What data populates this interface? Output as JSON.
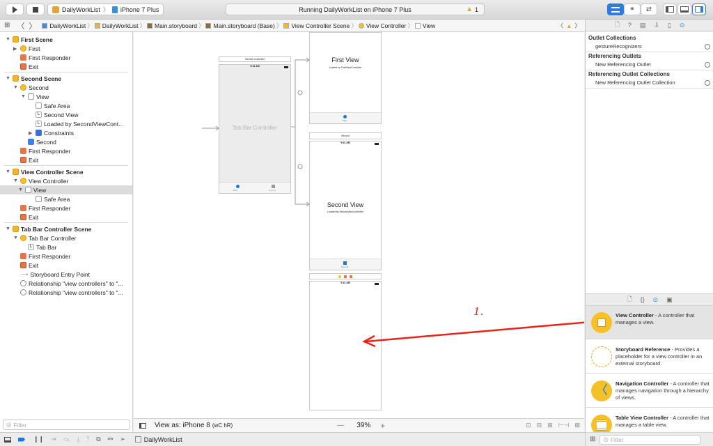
{
  "toolbar": {
    "scheme_name": "DailyWorkList",
    "device": "iPhone 7 Plus",
    "activity": "Running DailyWorkList on iPhone 7 Plus",
    "warning_count": "1"
  },
  "jumpbar": {
    "crumbs": [
      "DailyWorkList",
      "DailyWorkList",
      "Main.storyboard",
      "Main.storyboard (Base)",
      "View Controller Scene",
      "View Controller",
      "View"
    ]
  },
  "navigator": {
    "items": [
      {
        "label": "First Scene",
        "indent": 0,
        "icon": "scene",
        "disc": "▼",
        "bold": true
      },
      {
        "label": "First",
        "indent": 1,
        "icon": "vc",
        "disc": "▶"
      },
      {
        "label": "First Responder",
        "indent": 1,
        "icon": "resp"
      },
      {
        "label": "Exit",
        "indent": 1,
        "icon": "exit"
      },
      {
        "label": "Second Scene",
        "indent": 0,
        "icon": "scene",
        "disc": "▼",
        "bold": true
      },
      {
        "label": "Second",
        "indent": 1,
        "icon": "vc",
        "disc": "▼"
      },
      {
        "label": "View",
        "indent": 2,
        "icon": "view",
        "disc": "▼"
      },
      {
        "label": "Safe Area",
        "indent": 3,
        "icon": "view"
      },
      {
        "label": "Second View",
        "indent": 3,
        "icon": "label"
      },
      {
        "label": "Loaded by SecondViewCont...",
        "indent": 3,
        "icon": "label"
      },
      {
        "label": "Constraints",
        "indent": 3,
        "icon": "constr",
        "disc": "▶"
      },
      {
        "label": "Second",
        "indent": 2,
        "icon": "tab"
      },
      {
        "label": "First Responder",
        "indent": 1,
        "icon": "resp"
      },
      {
        "label": "Exit",
        "indent": 1,
        "icon": "exit"
      },
      {
        "label": "View Controller Scene",
        "indent": 0,
        "icon": "scene",
        "disc": "▼",
        "bold": true
      },
      {
        "label": "View Controller",
        "indent": 1,
        "icon": "vc",
        "disc": "▼"
      },
      {
        "label": "View",
        "indent": 2,
        "icon": "view",
        "disc": "▼",
        "selected": true
      },
      {
        "label": "Safe Area",
        "indent": 3,
        "icon": "view"
      },
      {
        "label": "First Responder",
        "indent": 1,
        "icon": "resp"
      },
      {
        "label": "Exit",
        "indent": 1,
        "icon": "exit"
      },
      {
        "label": "Tab Bar Controller Scene",
        "indent": 0,
        "icon": "scene",
        "disc": "▼",
        "bold": true
      },
      {
        "label": "Tab Bar Controller",
        "indent": 1,
        "icon": "vc",
        "disc": "▼"
      },
      {
        "label": "Tab Bar",
        "indent": 2,
        "icon": "label"
      },
      {
        "label": "First Responder",
        "indent": 1,
        "icon": "resp"
      },
      {
        "label": "Exit",
        "indent": 1,
        "icon": "exit"
      },
      {
        "label": "Storyboard Entry Point",
        "indent": 1,
        "icon": "arrow"
      },
      {
        "label": "Relationship \"view controllers\" to \"...",
        "indent": 1,
        "icon": "circle"
      },
      {
        "label": "Relationship \"view controllers\" to \"...",
        "indent": 1,
        "icon": "circle"
      }
    ],
    "filter_placeholder": "Filter"
  },
  "canvas": {
    "tab_bar_controller": {
      "title": "Tab Bar Controller",
      "label": "Tab Bar Controller",
      "tab1": "First",
      "tab2": "Second",
      "time": "9:41 AM"
    },
    "first_view": {
      "title": "First View",
      "subtitle": "Loaded by FirstViewController",
      "tab": "First"
    },
    "second_view": {
      "header": "Second",
      "title": "Second View",
      "subtitle": "Loaded by SecondViewController",
      "tab": "Second",
      "time": "9:41 AM"
    },
    "new_view": {
      "time": "9:41 AM"
    },
    "annotation": "1."
  },
  "canvasbar": {
    "view_as": "View as: iPhone 8",
    "size_class": "(wC hR)",
    "zoom": "39%",
    "minus": "—",
    "plus": "+"
  },
  "bottombar": {
    "target": "DailyWorkList"
  },
  "inspector": {
    "sections": [
      {
        "title": "Outlet Collections",
        "rows": [
          "gestureRecognizers"
        ]
      },
      {
        "title": "Referencing Outlets",
        "rows": [
          "New Referencing Outlet"
        ]
      },
      {
        "title": "Referencing Outlet Collections",
        "rows": [
          "New Referencing Outlet Collection"
        ]
      }
    ]
  },
  "library": {
    "items": [
      {
        "title": "View Controller",
        "desc": " - A controller that manages a view.",
        "color": "#f6c128"
      },
      {
        "title": "Storyboard Reference",
        "desc": " - Provides a placeholder for a view controller in an external storyboard.",
        "color": "#ffffff"
      },
      {
        "title": "Navigation Controller",
        "desc": " - A controller that manages navigation through a hierarchy of views.",
        "color": "#f6c128"
      },
      {
        "title": "Table View Controller",
        "desc": " - A controller that manages a table view.",
        "color": "#f6c128"
      }
    ],
    "filter_placeholder": "Filter"
  },
  "colors": {
    "accent": "#1a7bd6",
    "annotation_red": "#e8241a",
    "scene_yellow": "#f3b626"
  }
}
